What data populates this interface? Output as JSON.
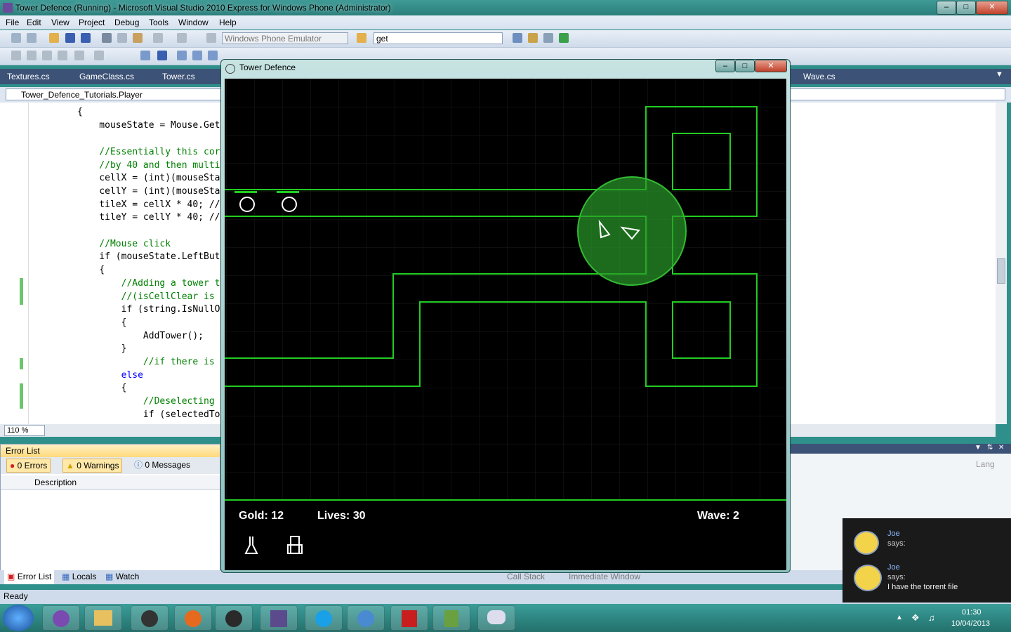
{
  "vs": {
    "title": "Tower Defence (Running) - Microsoft Visual Studio 2010 Express for Windows Phone (Administrator)",
    "menu": [
      "File",
      "Edit",
      "View",
      "Project",
      "Debug",
      "Tools",
      "Window",
      "Help"
    ],
    "target_combo": "Windows Phone Emulator",
    "find_combo": "get",
    "doc_tabs": [
      "Textures.cs",
      "GameClass.cs",
      "Tower.cs",
      "Wave.cs"
    ],
    "nav_class": "Tower_Defence_Tutorials.Player",
    "code_lines": [
      "{",
      "    mouseState = Mouse.Get",
      "",
      "    //Essentially this cor",
      "    //by 40 and then multi",
      "    cellX = (int)(mouseSta",
      "    cellY = (int)(mouseSta",
      "    tileX = cellX * 40; //",
      "    tileY = cellY * 40; //",
      "",
      "    //Mouse click",
      "    if (mouseState.LeftBut",
      "    {",
      "        //Adding a tower t",
      "        //(isCellClear is ",
      "        if (string.IsNullO",
      "        {",
      "            AddTower();",
      "        }",
      "            //if there is ",
      "        else",
      "        {",
      "            //Deselecting ",
      "            if (selectedTo"
    ],
    "zoom": "110 %",
    "error_list": {
      "title": "Error List",
      "errors": "0 Errors",
      "warnings": "0 Warnings",
      "messages": "0 Messages",
      "col_description": "Description"
    },
    "right_panel_col": "Lang",
    "bottom_tabs": [
      "Error List",
      "Locals",
      "Watch"
    ],
    "right_tabs": [
      "Call Stack",
      "Immediate Window"
    ],
    "status": "Ready"
  },
  "game": {
    "window_title": "Tower Defence",
    "gold": "Gold: 12",
    "lives": "Lives: 30",
    "wave": "Wave: 2",
    "path_color": "#22cc22"
  },
  "chat": {
    "name1": "Joe",
    "says1": "says:",
    "name2": "Joe",
    "says2": "says:",
    "message2": "I have the torrent file"
  },
  "clock": {
    "time": "01:30",
    "date": "10/04/2013"
  }
}
